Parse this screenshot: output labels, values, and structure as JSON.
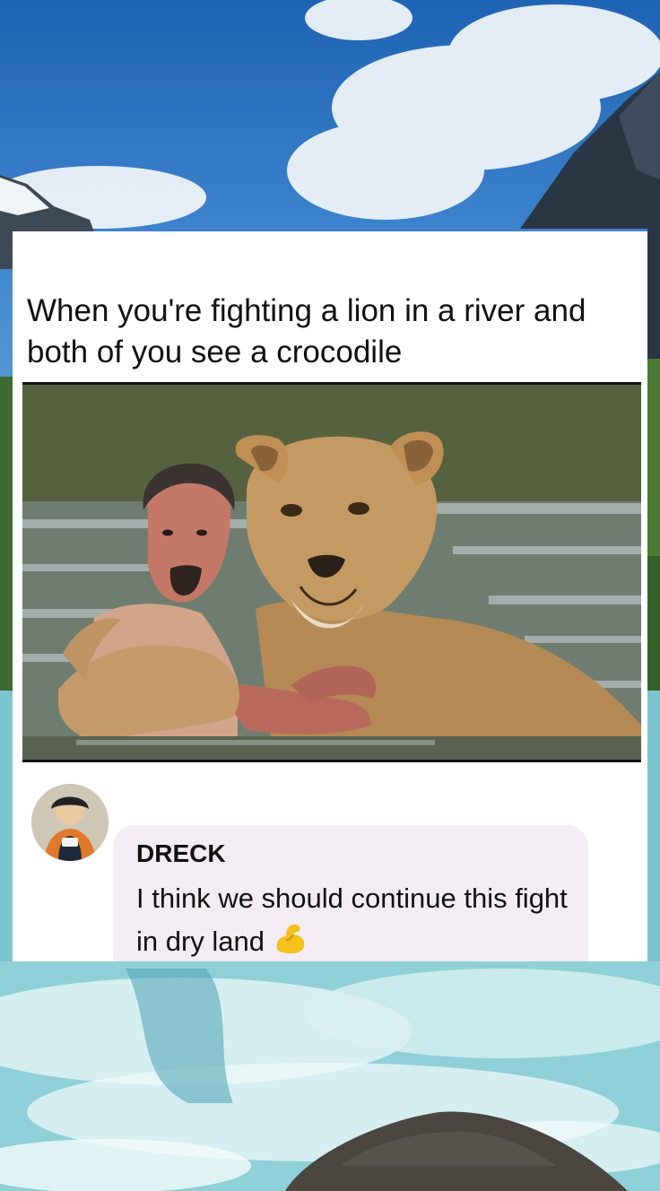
{
  "meme": {
    "caption": "When you're fighting a lion in a river and both of you see a crocodile"
  },
  "comment": {
    "author": "DRECK",
    "text": "I think we should continue this fight in dry land",
    "emoji": "flexed-biceps-icon"
  },
  "colors": {
    "card_background": "#ffffff",
    "bubble_background": "#f3edf3",
    "sky": "#2a6fb0",
    "water": "#7cc4cf"
  }
}
